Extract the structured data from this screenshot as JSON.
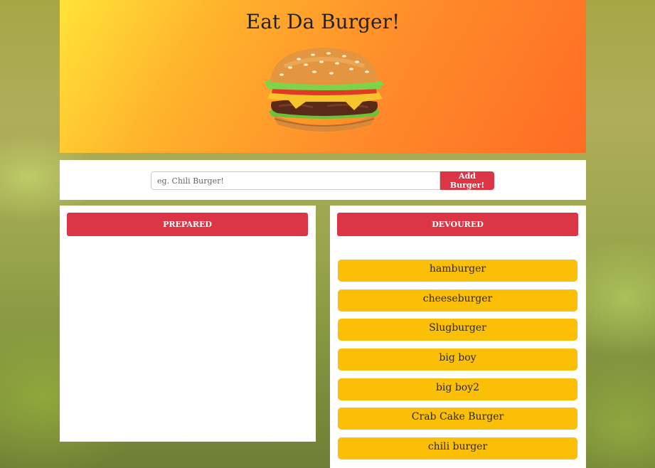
{
  "header": {
    "title": "Eat Da Burger!",
    "image": "burger-photo"
  },
  "form": {
    "placeholder": "eg. Chili Burger!",
    "value": "",
    "button_label": "Add Burger!"
  },
  "prepared": {
    "heading": "PREPARED",
    "items": []
  },
  "devoured": {
    "heading": "DEVOURED",
    "items": [
      {
        "name": "hamburger"
      },
      {
        "name": "cheeseburger"
      },
      {
        "name": "Slugburger"
      },
      {
        "name": "big boy"
      },
      {
        "name": "big boy2"
      },
      {
        "name": "Crab Cake Burger"
      },
      {
        "name": "chili burger"
      }
    ]
  },
  "colors": {
    "header_gradient_start": "#ffe338",
    "header_gradient_end": "#ff6b25",
    "button_red": "#dc3545",
    "item_yellow": "#fbbf08"
  }
}
